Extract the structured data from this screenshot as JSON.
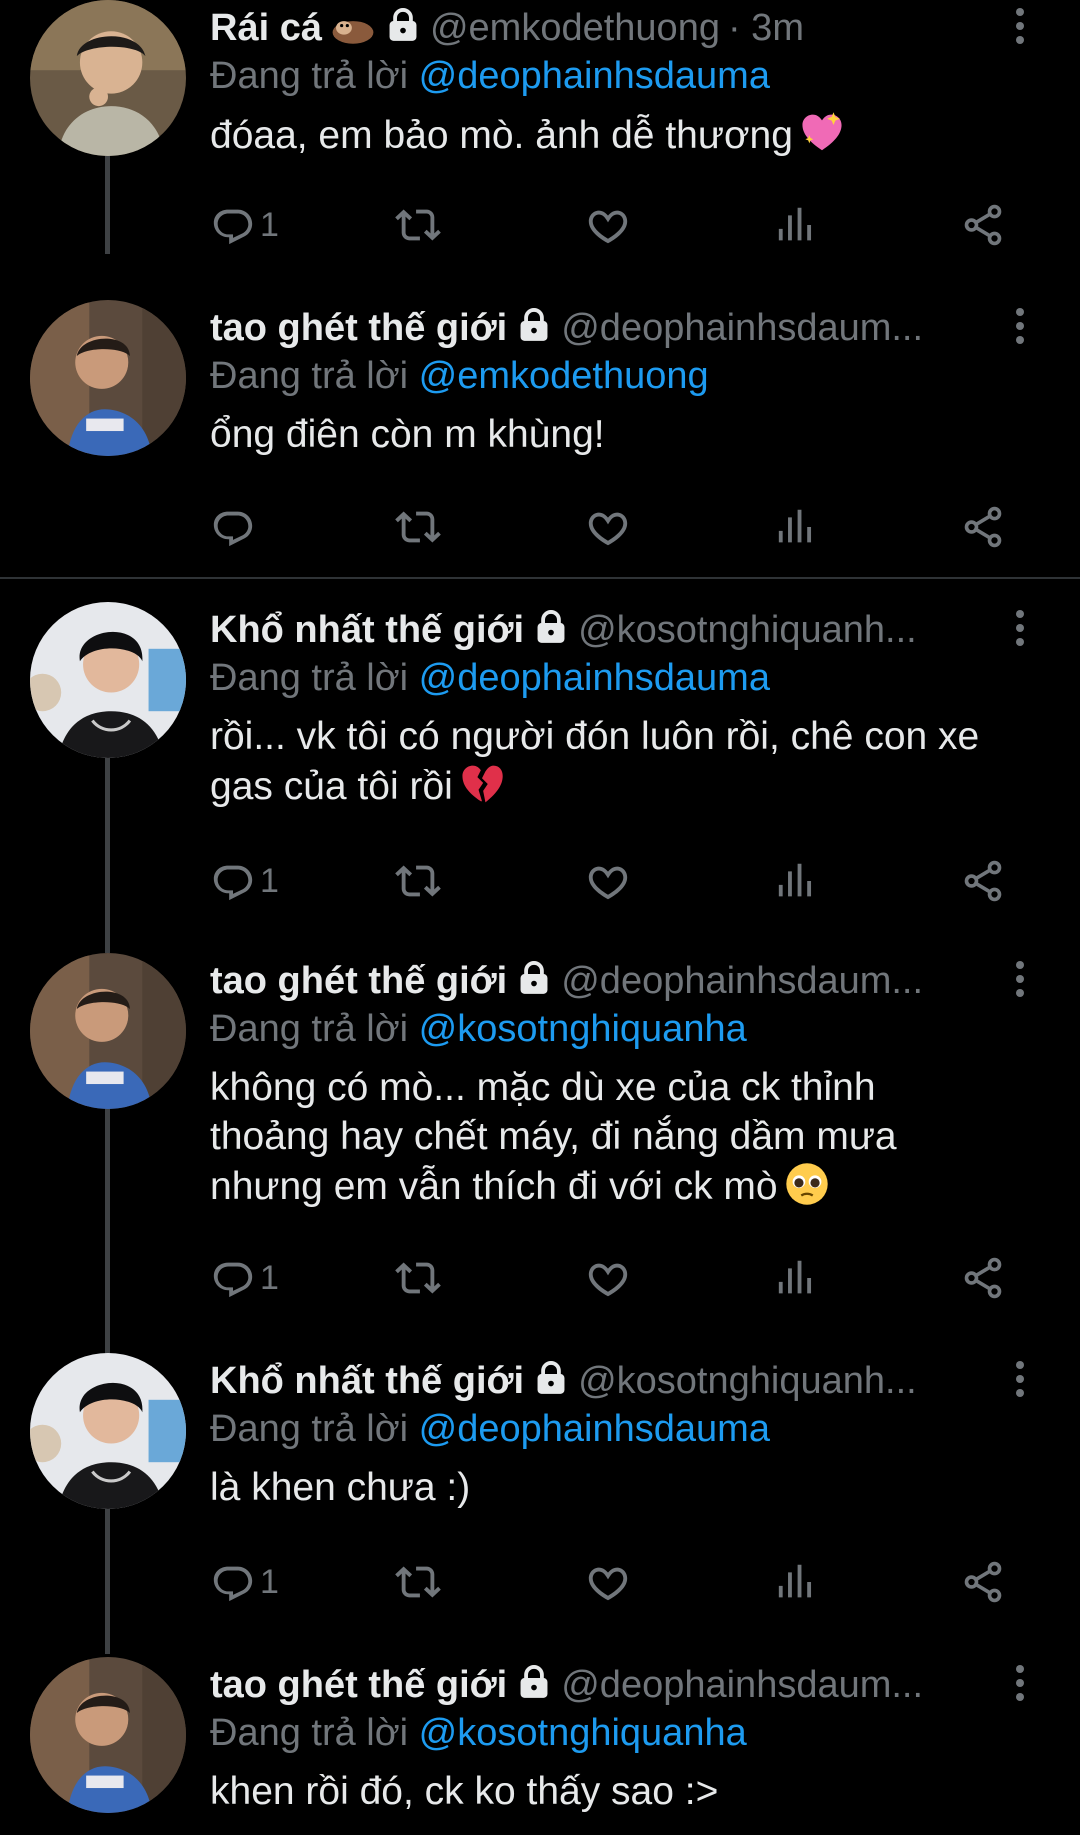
{
  "labels": {
    "replying_to": "Đang trả lời"
  },
  "colors": {
    "background": "#000000",
    "text": "#e7e9ea",
    "muted": "#71767b",
    "mention": "#1d9bf0",
    "line": "#3e4144"
  },
  "tweets": [
    {
      "name": "Rái cá",
      "name_emoji": "otter",
      "locked": true,
      "handle": "@emkodethuong",
      "time": "· 3m",
      "reply_to": "@deophainhsdauma",
      "text": "đóaa, em bảo mò. ảnh dễ thương",
      "text_emoji": "sparkling-heart",
      "reply_count": "1"
    },
    {
      "name": "tao ghét thế giới",
      "locked": true,
      "handle": "@deophainhsdaum...",
      "reply_to": "@emkodethuong",
      "text": "ổng điên còn m khùng!",
      "reply_count": ""
    },
    {
      "name": "Khổ nhất thế giới",
      "locked": true,
      "handle": "@kosotnghiquanh...",
      "reply_to": "@deophainhsdauma",
      "text": "rồi... vk tôi có người đón luôn rồi, chê con xe gas của tôi rồi",
      "text_emoji": "broken-heart",
      "reply_count": "1"
    },
    {
      "name": "tao ghét thế giới",
      "locked": true,
      "handle": "@deophainhsdaum...",
      "reply_to": "@kosotnghiquanha",
      "text": "không có mò... mặc dù xe của ck thỉnh thoảng hay chết máy, đi nắng dầm mưa nhưng em vẫn thích đi với ck mò",
      "text_emoji": "pleading-face",
      "reply_count": "1"
    },
    {
      "name": "Khổ nhất thế giới",
      "locked": true,
      "handle": "@kosotnghiquanh...",
      "reply_to": "@deophainhsdauma",
      "text": "là khen chưa :)",
      "reply_count": "1"
    },
    {
      "name": "tao ghét thế giới",
      "locked": true,
      "handle": "@deophainhsdaum...",
      "reply_to": "@kosotnghiquanha",
      "text": "khen rồi đó, ck ko thấy sao :>"
    }
  ]
}
